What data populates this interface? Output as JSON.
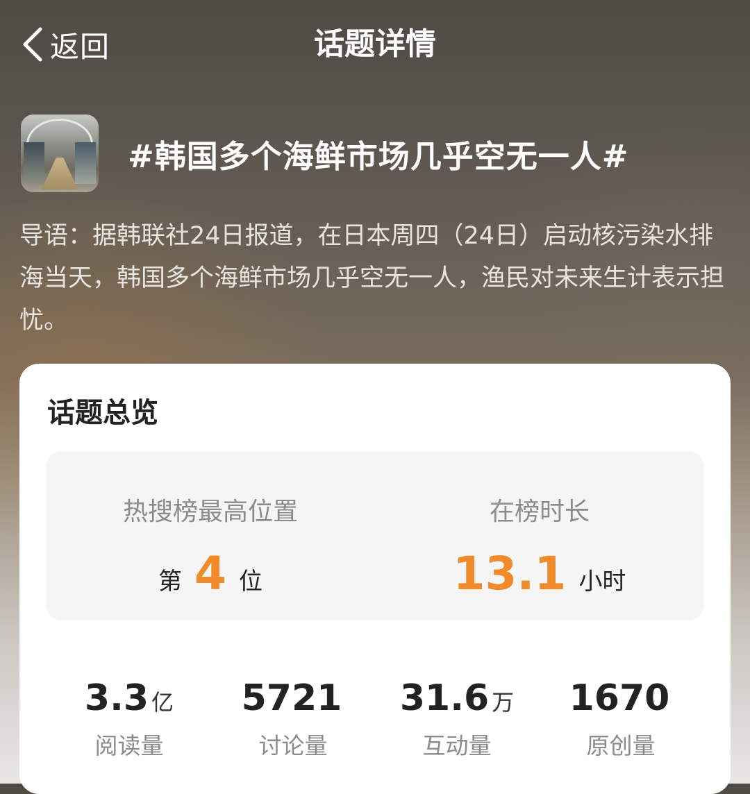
{
  "nav": {
    "back_label": "返回",
    "title": "话题详情"
  },
  "topic": {
    "title": "#韩国多个海鲜市场几乎空无一人#",
    "intro": "导语：据韩联社24日报道，在日本周四（24日）启动核污染水排海当天，韩国多个海鲜市场几乎空无一人，渔民对未来生计表示担忧。"
  },
  "overview": {
    "title": "话题总览",
    "rank": {
      "label": "热搜榜最高位置",
      "prefix": "第",
      "value": "4",
      "suffix": "位"
    },
    "duration": {
      "label": "在榜时长",
      "value": "13.1",
      "unit": "小时"
    },
    "stats": [
      {
        "value": "3.3",
        "unit": "亿",
        "label": "阅读量"
      },
      {
        "value": "5721",
        "unit": "",
        "label": "讨论量"
      },
      {
        "value": "31.6",
        "unit": "万",
        "label": "互动量"
      },
      {
        "value": "1670",
        "unit": "",
        "label": "原创量"
      }
    ]
  },
  "colors": {
    "accent": "#f08a2b",
    "card_bg": "#ffffff",
    "rank_box_bg": "#f5f5f5"
  }
}
